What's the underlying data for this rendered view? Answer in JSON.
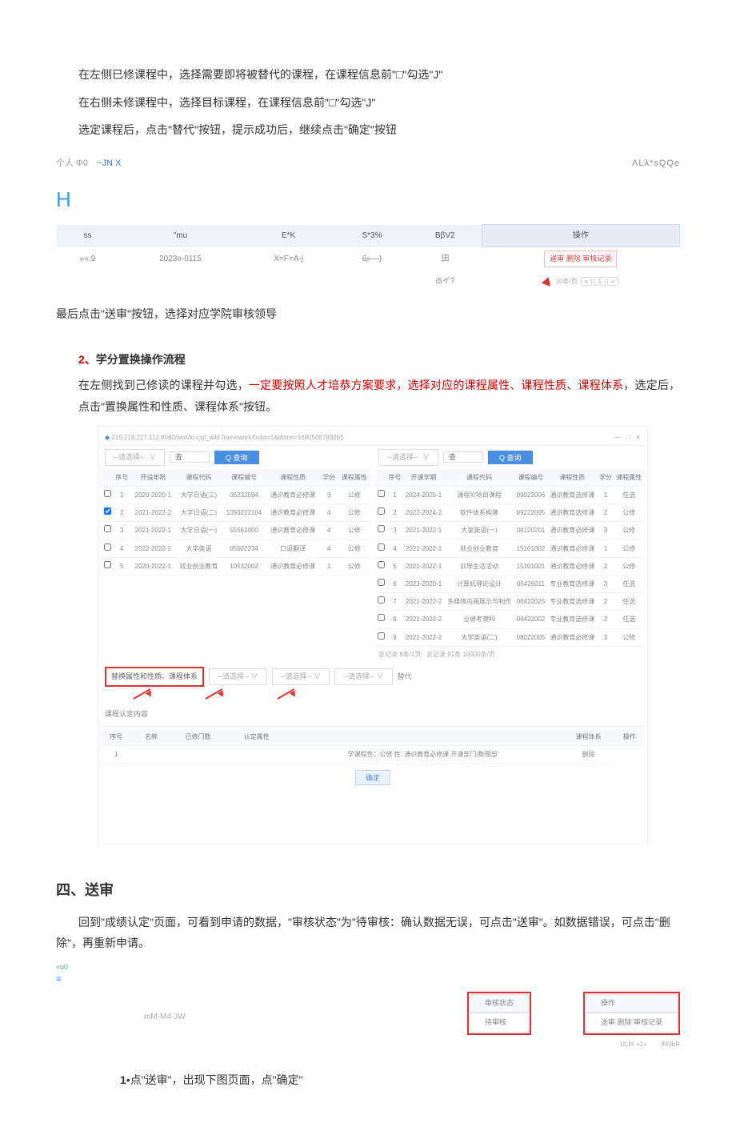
{
  "paragraphs": {
    "p1": "在左侧已修课程中，选择需要即将被替代的课程，在课程信息前\"□\"勾选\"J\"",
    "p2": "在右侧未修课程中，选择目标课程，在课程信息前\"□\"勾选\"J\"",
    "p3": "选定课程后，点击\"替代\"按钮，提示成功后，继续点击\"确定\"按钮",
    "tabs_left": "个人 Φ0",
    "tabs_right": "~JN X",
    "top_right": "ΛLλ*sQQe",
    "p4": "最后点击\"送审\"按钮，选择对应学院审核领导"
  },
  "small_table": {
    "headers": [
      "ss",
      "\"mu",
      "E*K",
      "S*3%",
      "BβV2",
      "操作"
    ],
    "row": [
      "««.9",
      "2023o-0115",
      "X=F=A-j",
      "6»—)",
      "田"
    ],
    "action": "送审 删除 审核记录",
    "count": "ι5イ?",
    "pager_label": "10条/页",
    "pager_btns": [
      "«",
      "1",
      "»"
    ]
  },
  "section2": {
    "title_num": "2、",
    "title_text": "学分置换操作流程",
    "body_pre": "在左侧找到己修读的课程并勾选，",
    "body_red": "一定要按照人才培恭方案要求，选择对应的课程属性、课程性质、课程体系",
    "body_post": "，选定后，点击\"置换属性和性质、课程体系\"按钮。"
  },
  "screenshot": {
    "url": "219.218.227.112:8080/jwxt/kccjgl_add.framework/fxdw=1&dtime=1680508789265",
    "select_placeholder": "--请选择--",
    "search_label": "Q 查询",
    "search_char": "查",
    "left_headers": [
      "序号",
      "开设年限",
      "课程代码",
      "课程编号",
      "课程性质",
      "学分",
      "课程属性"
    ],
    "right_headers": [
      "序号",
      "开课学期",
      "课程代码",
      "课程编号",
      "课程性质",
      "学分",
      "课程属性"
    ],
    "left_rows": [
      {
        "n": "1",
        "term": "2020-2020-1",
        "name": "大学日语(三)",
        "code": "05232594",
        "type": "通识教育必修课",
        "credit": "3",
        "attr": "公修"
      },
      {
        "n": "2",
        "term": "2021-2022-2",
        "name": "大学日语(二)",
        "code": "1050222104",
        "type": "通识教育必修课",
        "credit": "4",
        "attr": "公修",
        "checked": true
      },
      {
        "n": "3",
        "term": "2021-2022-1",
        "name": "大学日语(一)",
        "code": "55561000",
        "type": "通识教育必修课",
        "credit": "4",
        "attr": "公修"
      },
      {
        "n": "4",
        "term": "2022-2022-2",
        "name": "大学英语",
        "code": "05502234",
        "type": "口语翻译",
        "credit": "4",
        "attr": "公修"
      },
      {
        "n": "5",
        "term": "2020-2022-1",
        "name": "就业创业教育",
        "code": "10532002",
        "type": "通识教育必修课",
        "credit": "1",
        "attr": "公修"
      }
    ],
    "right_rows": [
      {
        "n": "1",
        "term": "2024-2025-1",
        "name": "课程X/项目课程",
        "code": "09022006",
        "type": "通识教育选修课",
        "credit": "1",
        "attr": "任选"
      },
      {
        "n": "2",
        "term": "2022-2024-2",
        "name": "软件体系构建",
        "code": "09222005",
        "type": "通识教育选修课",
        "credit": "2",
        "attr": "公修"
      },
      {
        "n": "3",
        "term": "2021-2022-1",
        "name": "大家英语(一)",
        "code": "08120201",
        "type": "通识教育必修课",
        "credit": "3",
        "attr": "公修"
      },
      {
        "n": "4",
        "term": "2021-2022-1",
        "name": "就业创业教育",
        "code": "15101002",
        "type": "通识教育必修课",
        "credit": "1",
        "attr": "公修"
      },
      {
        "n": "5",
        "term": "2021-2022-1",
        "name": "训导生活活动",
        "code": "15101001",
        "type": "通识教育必修课",
        "credit": "2",
        "attr": "公修"
      },
      {
        "n": "6",
        "term": "2023-2020-1",
        "name": "计算机理论设计",
        "code": "05426011",
        "type": "专业教育选修课",
        "credit": "3",
        "attr": "任选"
      },
      {
        "n": "7",
        "term": "2021-2022-2",
        "name": "多媒体内画展示与制作",
        "code": "06422025",
        "type": "专业教育选修课",
        "credit": "2",
        "attr": "任选"
      },
      {
        "n": "8",
        "term": "2021-2022-2",
        "name": "业绩考察科",
        "code": "06422002",
        "type": "专业教育选修课",
        "credit": "2",
        "attr": "任选"
      },
      {
        "n": "9",
        "term": "2021-2022-2",
        "name": "大学英语(二)",
        "code": "08022005",
        "type": "通识教育必修课",
        "credit": "3",
        "attr": "公修"
      }
    ],
    "red_btn": "替换属性和性质、课程体系",
    "subtitle": "课程认定内容",
    "extra_row_labels": [
      "序号",
      "",
      "名称",
      "",
      "已修门数",
      "",
      "认定属性",
      "",
      "课程体系",
      "操作"
    ],
    "extra_row_cells": [
      "1",
      "",
      "",
      "",
      "",
      "",
      "",
      "学课程性：公修 性: 通识教育必修课  开课部门/数理部",
      "删除"
    ],
    "pager_right": "总记录 91条 10000条/页",
    "page_left": "总记录 8条/1页",
    "confirm": "确定",
    "replace_label": "替代"
  },
  "section4": {
    "heading": "四、送审",
    "body": "回到\"成绩认定\"页面，可看到申请的数据，\"审核状态\"为\"待审核：确认数据无误，可点击\"送审\"。如数据错误，可点击\"删除\"，再重新申请。",
    "indicator": "«u0",
    "mid_text": "mM-M4-JW",
    "status_col": "审核状态",
    "status_val": "待审核",
    "op_col": "操作",
    "op_val": "送审 删除 审核记录",
    "footer_left": "ULIX «1»",
    "footer_right": "IM3bR"
  },
  "step1": {
    "num": "1",
    "bullet": "•",
    "text": "点\"送审\"，出现下图页面，点\"确定\""
  }
}
